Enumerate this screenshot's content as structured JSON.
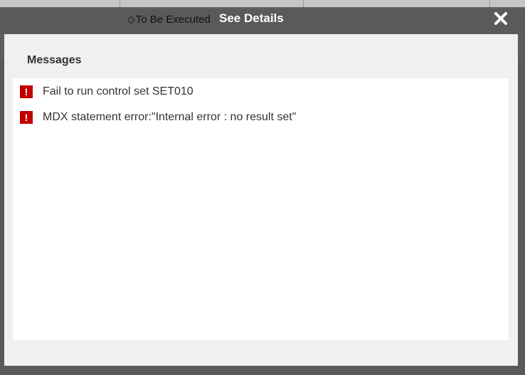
{
  "background": {
    "status_text": "To Be Executed",
    "status_icon": "diamond-outline-icon"
  },
  "dialog": {
    "title": "See Details",
    "close_icon": "close-icon",
    "section_title": "Messages",
    "messages": [
      {
        "icon": "error-icon",
        "text": "Fail to run control set SET010"
      },
      {
        "icon": "error-icon",
        "text": "MDX statement error:\"Internal error : no result set\""
      }
    ]
  },
  "colors": {
    "overlay": "#595959",
    "body": "#f0f0f0",
    "panel": "#ffffff",
    "error": "#c00000",
    "accent_blue": "#5b9bd5"
  }
}
